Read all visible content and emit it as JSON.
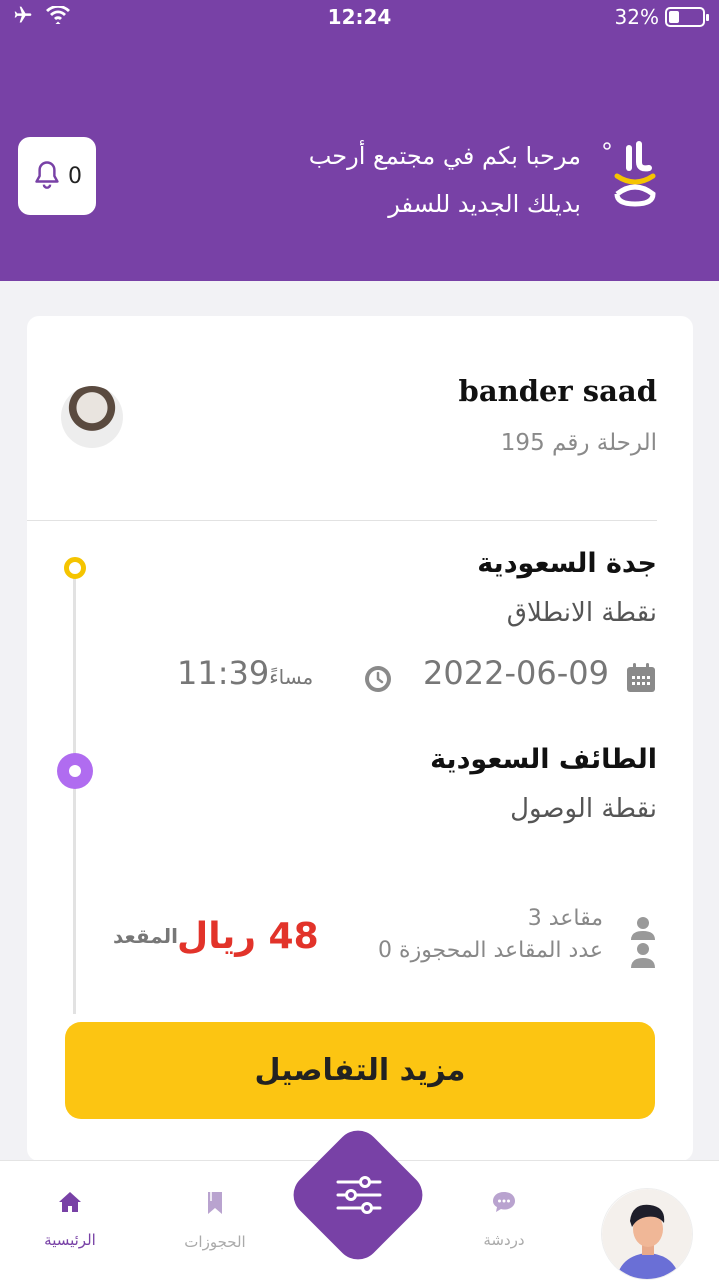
{
  "status_bar": {
    "time": "12:24",
    "battery_label": "32%",
    "battery_level": 0.32
  },
  "header": {
    "welcome_line1": "مرحبا بكم في مجتمع أرحب",
    "welcome_line2": "بديلك الجديد للسفر",
    "notification_count": "0",
    "colors": {
      "brand": "#7841a6",
      "accent": "#f5c400"
    }
  },
  "trip": {
    "driver_name": "bander saad",
    "trip_number": "الرحلة رقم 195",
    "origin_city": "جدة السعودية",
    "origin_label": "نقطة الانطلاق",
    "date": "2022-06-09",
    "time": "11:39",
    "time_suffix": "مساءً",
    "destination_city": "الطائف السعودية",
    "destination_label": "نقطة الوصول",
    "seats": "مقاعد 3",
    "booked_seats": "عدد المقاعد المحجوزة 0",
    "price": "48 ريال",
    "per_seat": "المقعد",
    "details_button": "مزيد التفاصيل"
  },
  "nav": {
    "home": "الرئيسية",
    "bookings": "الحجوزات",
    "chat": "دردشة",
    "icons": [
      "home-icon",
      "bookmark-icon",
      "filter-sliders-icon",
      "chat-icon",
      "profile-avatar"
    ]
  }
}
